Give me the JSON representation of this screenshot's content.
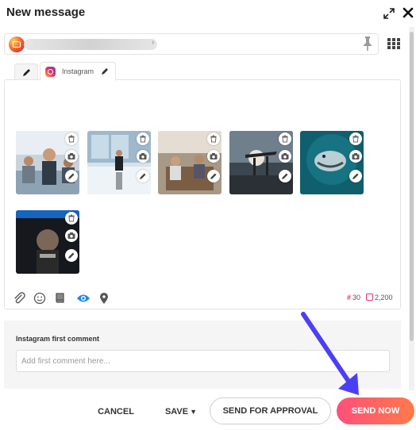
{
  "header": {
    "title": "New message"
  },
  "icons": {
    "expand": "expand-icon",
    "close": "close-icon",
    "pin": "pin-icon",
    "grid": "grid-icon",
    "tab_edit": "pencil-icon",
    "instagram": "instagram-icon"
  },
  "tabs": [
    {
      "label": "Instagram"
    }
  ],
  "media": [
    {
      "name": "office-meeting-photo"
    },
    {
      "name": "boardroom-reflection-photo"
    },
    {
      "name": "workshop-table-photo"
    },
    {
      "name": "pier-sunset-photo"
    },
    {
      "name": "underwater-shark-photo"
    },
    {
      "name": "webpage-screenshot-photo"
    }
  ],
  "toolbar": {
    "icons": [
      "attachment-icon",
      "emoji-icon",
      "book-icon",
      "preview-icon",
      "location-icon"
    ],
    "hashtag_count": "30",
    "char_count": "2,200"
  },
  "first_comment": {
    "label": "Instagram first comment",
    "placeholder": "Add first comment here..."
  },
  "footer": {
    "cancel": "CANCEL",
    "save": "SAVE",
    "send_for_approval": "SEND FOR APPROVAL",
    "send_now": "SEND NOW"
  },
  "colors": {
    "send_gradient_start": "#ff4f7b",
    "send_gradient_end": "#ff7a4a",
    "arrow": "#4b3ff5",
    "preview_icon": "#1e88e5",
    "instagram_pink": "#e1306c"
  }
}
